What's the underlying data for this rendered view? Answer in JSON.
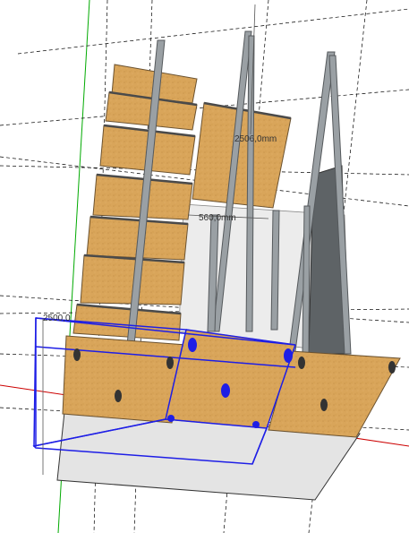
{
  "scene": {
    "dimensions": {
      "depth_label": "2506,0mm",
      "width_label": "560,0mm",
      "height_label": "2500,0"
    },
    "colors": {
      "background": "#ffffff",
      "wood": "#d9a55a",
      "wood_dark": "#b98637",
      "wood_edge": "#6b5230",
      "metal": "#9aa0a4",
      "metal_dark": "#55595c",
      "selection": "#1e1ee6",
      "guide": "#000000",
      "axis_red": "#cc0000",
      "axis_green": "#00aa00",
      "floor": "#e4e4e4",
      "wall": "#ececec",
      "shadow": "#5e6366"
    }
  }
}
